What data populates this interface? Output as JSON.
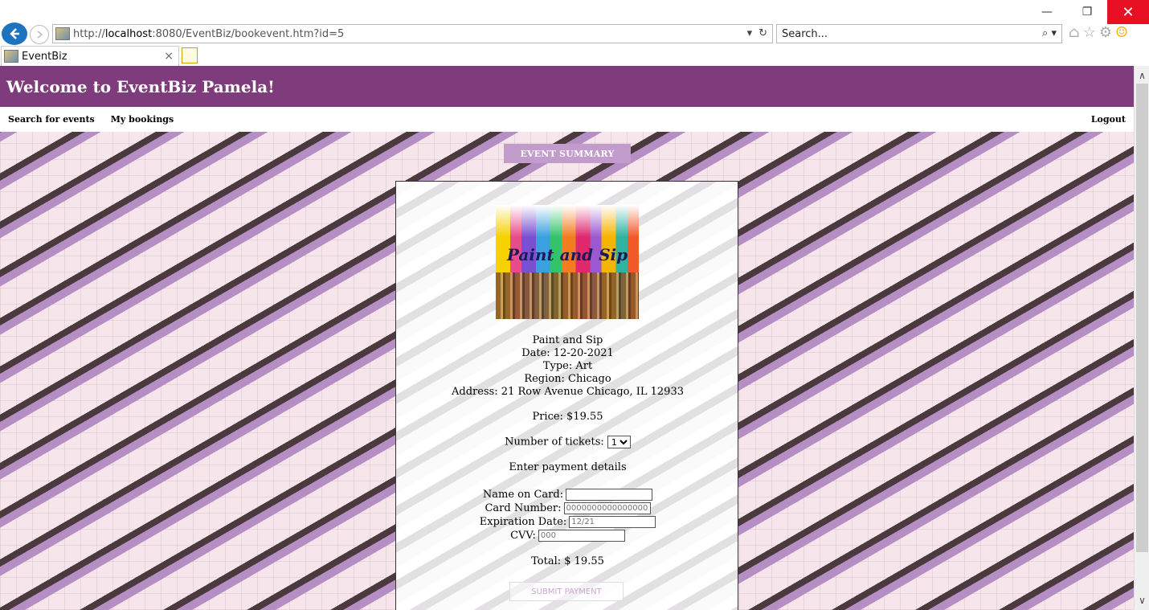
{
  "browser": {
    "url_prefix": "http://",
    "url_host": "localhost",
    "url_rest": ":8080/EventBiz/bookevent.htm?id=5",
    "search_placeholder": "Search...",
    "tab_title": "EventBiz",
    "window_controls": {
      "minimize": "—",
      "restore": "❐",
      "close": "✕"
    }
  },
  "header": {
    "title": "Welcome to EventBiz Pamela!"
  },
  "nav": {
    "search_events": "Search for events",
    "my_bookings": "My bookings",
    "logout": "Logout"
  },
  "summary": {
    "tab_label": "EVENT SUMMARY",
    "image_caption": "Paint and Sip",
    "event_name": "Paint and Sip",
    "date": "Date: 12-20-2021",
    "type": "Type: Art",
    "region": "Region: Chicago",
    "address": "Address: 21 Row Avenue Chicago, IL 12933",
    "price": "Price: $19.55",
    "tickets_label": "Number of tickets:",
    "tickets_value": "1",
    "payment_heading": "Enter payment details",
    "name_label": "Name on Card:",
    "name_value": "",
    "card_label": "Card Number:",
    "card_placeholder": "0000000000000000",
    "exp_label": "Expiration Date:",
    "exp_placeholder": "12/21",
    "cvv_label": "CVV:",
    "cvv_placeholder": "000",
    "total": "Total: $ 19.55",
    "submit_label": "SUBMIT PAYMENT"
  },
  "colors": {
    "header_bg": "#7e3c7c",
    "summary_tab_bg": "#c29dcb",
    "close_button": "#e81123"
  }
}
